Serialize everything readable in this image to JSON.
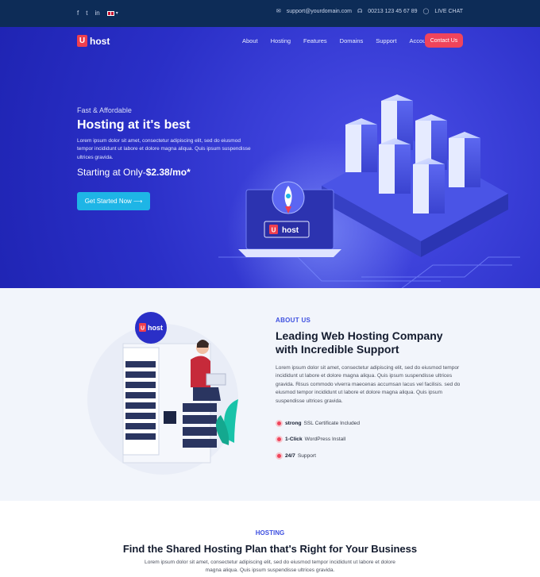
{
  "topbar": {
    "social": [
      "f",
      "t",
      "in"
    ],
    "email": "support@yourdomain.com",
    "phone": "00213 123 45 67 89",
    "chat": "LIVE CHAT"
  },
  "brand": {
    "mark": "U",
    "name": "host"
  },
  "nav": {
    "items": [
      "About",
      "Hosting",
      "Features",
      "Domains",
      "Support",
      "Account"
    ],
    "cta": "Contact Us"
  },
  "hero": {
    "tag": "Fast & Affordable",
    "title": "Hosting at it's best",
    "desc": "Lorem ipsum dolor sit amet, consectetur adipiscing elit, sed do eiusmod tempor incididunt ut labore et dolore magna aliqua. Quis ipsum suspendisse ultrices gravida.",
    "price_prefix": "Starting at Only-",
    "price_value": "$2.38/mo*",
    "button": "Get Started Now",
    "laptop_logo_mark": "U",
    "laptop_logo_name": "host"
  },
  "about": {
    "kicker": "ABOUT US",
    "title": "Leading Web Hosting Company with Incredible Support",
    "body": "Lorem ipsum dolor sit amet, consectetur adipiscing elit, sed do eiusmod tempor incididunt ut labore et dolore magna aliqua. Quis ipsum suspendisse ultrices gravida. Risus commodo viverra maecenas accumsan lacus vel facilisis. sed do eiusmod tempor incididunt ut labore et dolore magna aliqua. Quis ipsum suspendisse ultrices gravida.",
    "features": [
      {
        "bold": "strong",
        "text": "SSL Certificate Included"
      },
      {
        "bold": "1-Click",
        "text": "WordPress Install"
      },
      {
        "bold": "24/7",
        "text": "Support"
      }
    ],
    "badge_mark": "U",
    "badge_name": "host"
  },
  "hosting": {
    "kicker": "HOSTING",
    "title": "Find the Shared Hosting Plan that's Right for Your Business",
    "body": "Lorem ipsum dolor sit amet, consectetur adipiscing elit, sed do eiusmod tempor incididunt ut labore et dolore magna aliqua. Quis ipsum suspendisse ultrices gravida."
  }
}
